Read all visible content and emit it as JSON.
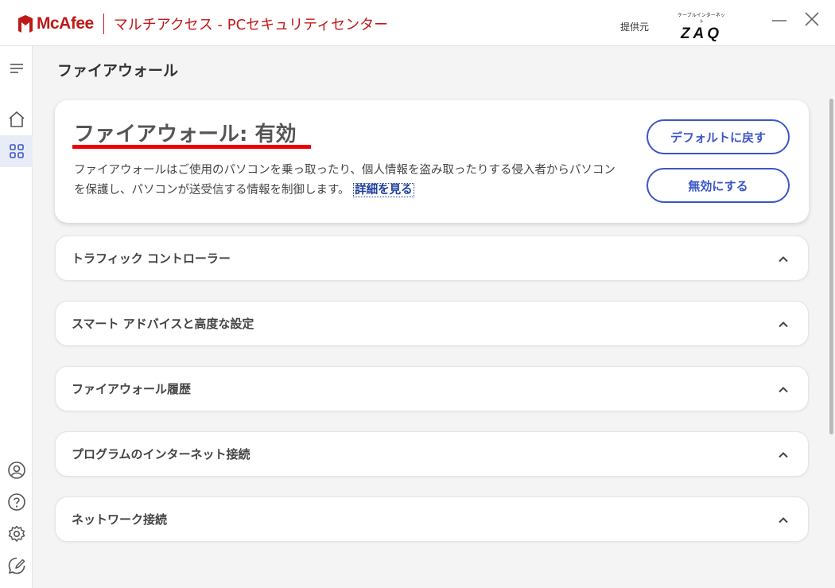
{
  "titlebar": {
    "brand": "McAfee",
    "app_title": "マルチアクセス - PCセキュリティセンター",
    "provider_label": "提供元",
    "provider_small": "ケーブルインターネット",
    "provider_logo": "ZAQ",
    "minimize_icon": "minimize-icon",
    "close_icon": "close-icon"
  },
  "rail": {
    "items": [
      {
        "icon": "menu-icon"
      },
      {
        "icon": "home-icon"
      },
      {
        "icon": "apps-grid-icon"
      },
      {
        "icon": "account-icon"
      },
      {
        "icon": "help-icon"
      },
      {
        "icon": "settings-gear-icon"
      },
      {
        "icon": "feedback-icon"
      }
    ]
  },
  "page": {
    "title": "ファイアウォール"
  },
  "hero": {
    "title": "ファイアウォール: 有効",
    "description": "ファイアウォールはご使用のパソコンを乗っ取ったり、個人情報を盗み取ったりする侵入者からパソコンを保護し、パソコンが送受信する情報を制御します。",
    "link": "詳細を見る",
    "btn_default": "デフォルトに戻す",
    "btn_disable": "無効にする"
  },
  "sections": [
    {
      "label": "トラフィック コントローラー"
    },
    {
      "label": "スマート アドバイスと高度な設定"
    },
    {
      "label": "ファイアウォール履歴"
    },
    {
      "label": "プログラムのインターネット接続"
    },
    {
      "label": "ネットワーク接続"
    }
  ],
  "colors": {
    "brand_red": "#c01818",
    "accent_blue": "#3b56c8",
    "highlight_red": "#ee0000"
  }
}
